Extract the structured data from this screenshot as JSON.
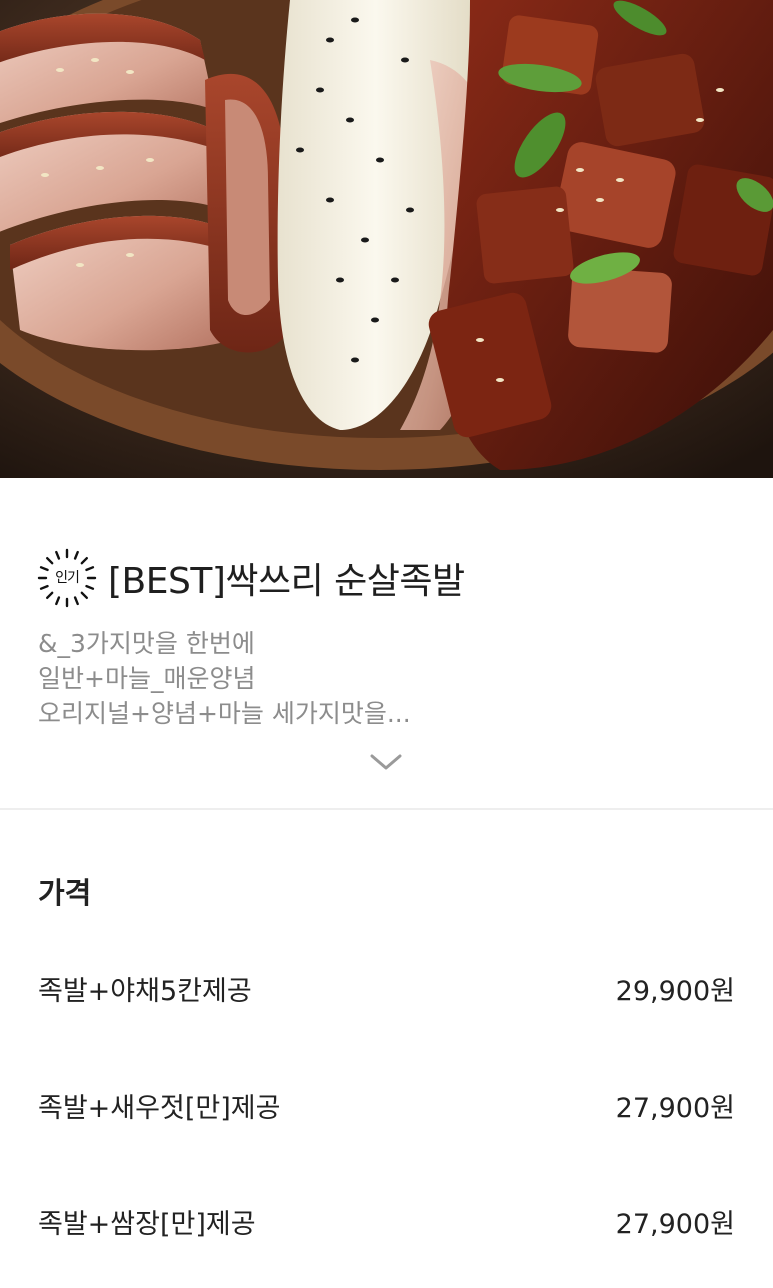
{
  "menu": {
    "badge": "인기",
    "title": "[BEST]싹쓰리 순살족발",
    "description_lines": [
      "&_3가지맛을 한번에",
      "일반+마늘_매운양념",
      "오리지널+양념+마늘 세가지맛을..."
    ],
    "expand_icon": "chevron-down-icon"
  },
  "price_section": {
    "heading": "가격",
    "options": [
      {
        "name": "족발+야채5칸제공",
        "price": "29,900원"
      },
      {
        "name": "족발+새우젓[만]제공",
        "price": "27,900원"
      },
      {
        "name": "족발+쌈장[만]제공",
        "price": "27,900원"
      }
    ]
  },
  "colors": {
    "title": "#1f1f1f",
    "description": "#8c8c8c",
    "divider": "#eeeeee"
  }
}
